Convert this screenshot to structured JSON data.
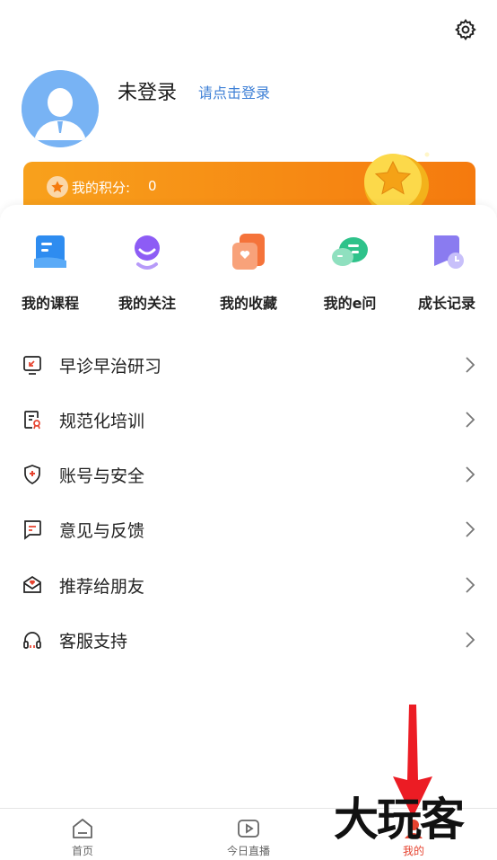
{
  "header": {
    "settings_icon": "gear-icon"
  },
  "profile": {
    "username": "未登录",
    "login_prompt": "请点击登录",
    "avatar_icon": "user-avatar-icon"
  },
  "points": {
    "label": "我的积分:",
    "value": "0",
    "icon": "star-badge-icon"
  },
  "quick_actions": [
    {
      "label": "我的课程",
      "icon": "course-icon",
      "color": "#2e8cf0"
    },
    {
      "label": "我的关注",
      "icon": "follow-icon",
      "color": "#8d5cf5"
    },
    {
      "label": "我的收藏",
      "icon": "favorite-icon",
      "color": "#f5733a"
    },
    {
      "label": "我的e问",
      "icon": "chat-icon",
      "color": "#2ec28a"
    },
    {
      "label": "成长记录",
      "icon": "record-icon",
      "color": "#8a7bf0"
    }
  ],
  "menu": [
    {
      "label": "早诊早治研习",
      "icon": "study-icon"
    },
    {
      "label": "规范化培训",
      "icon": "training-icon"
    },
    {
      "label": "账号与安全",
      "icon": "shield-icon"
    },
    {
      "label": "意见与反馈",
      "icon": "feedback-icon"
    },
    {
      "label": "推荐给朋友",
      "icon": "share-icon"
    },
    {
      "label": "客服支持",
      "icon": "headset-icon"
    }
  ],
  "bottom_nav": [
    {
      "label": "首页",
      "icon": "home-icon",
      "active": false
    },
    {
      "label": "今日直播",
      "icon": "live-play-icon",
      "active": false
    },
    {
      "label": "我的",
      "icon": "profile-icon",
      "active": true
    }
  ],
  "watermark": "大玩客",
  "colors": {
    "accent_blue": "#3d7fd6",
    "banner_orange": "#f78f15",
    "active_red": "#e6432f"
  }
}
